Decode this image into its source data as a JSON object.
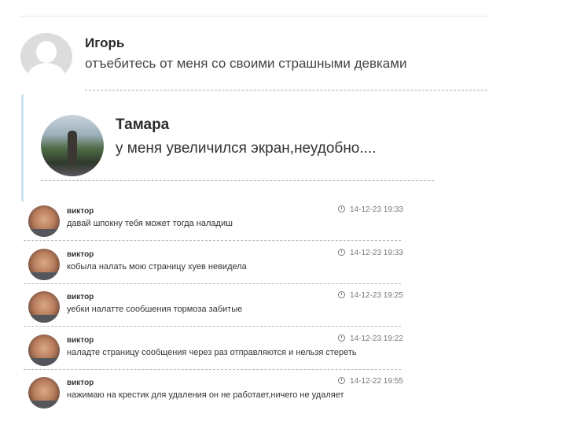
{
  "first_comment": {
    "author": "Игорь",
    "text": "отъебитесь от меня со своими страшными девками"
  },
  "reply_comment": {
    "author": "Тамара",
    "text": "у меня увеличился экран,неудобно...."
  },
  "comments": [
    {
      "author": "виктор",
      "text": "давай шпокну тебя может тогда наладиш",
      "time": "14-12-23 19:33"
    },
    {
      "author": "виктор",
      "text": "кобыла налать мою страницу хуев невидела",
      "time": "14-12-23 19:33"
    },
    {
      "author": "виктор",
      "text": "уебки налатте сообшения тормоза забитые",
      "time": "14-12-23 19:25"
    },
    {
      "author": "виктор",
      "text": "наладте страницу сообщения через раз отправляются и нельзя стереть",
      "time": "14-12-23 19:22"
    },
    {
      "author": "виктор",
      "text": "нажимаю на крестик для удаления он не работает,ничего не удаляет",
      "time": "14-12-22 19:55"
    }
  ],
  "colors": {
    "reply_bar": "#c9e3ef",
    "separator": "#b0b0b0"
  },
  "icons": {
    "time": "clock-icon",
    "default_avatar": "default-user-avatar"
  }
}
